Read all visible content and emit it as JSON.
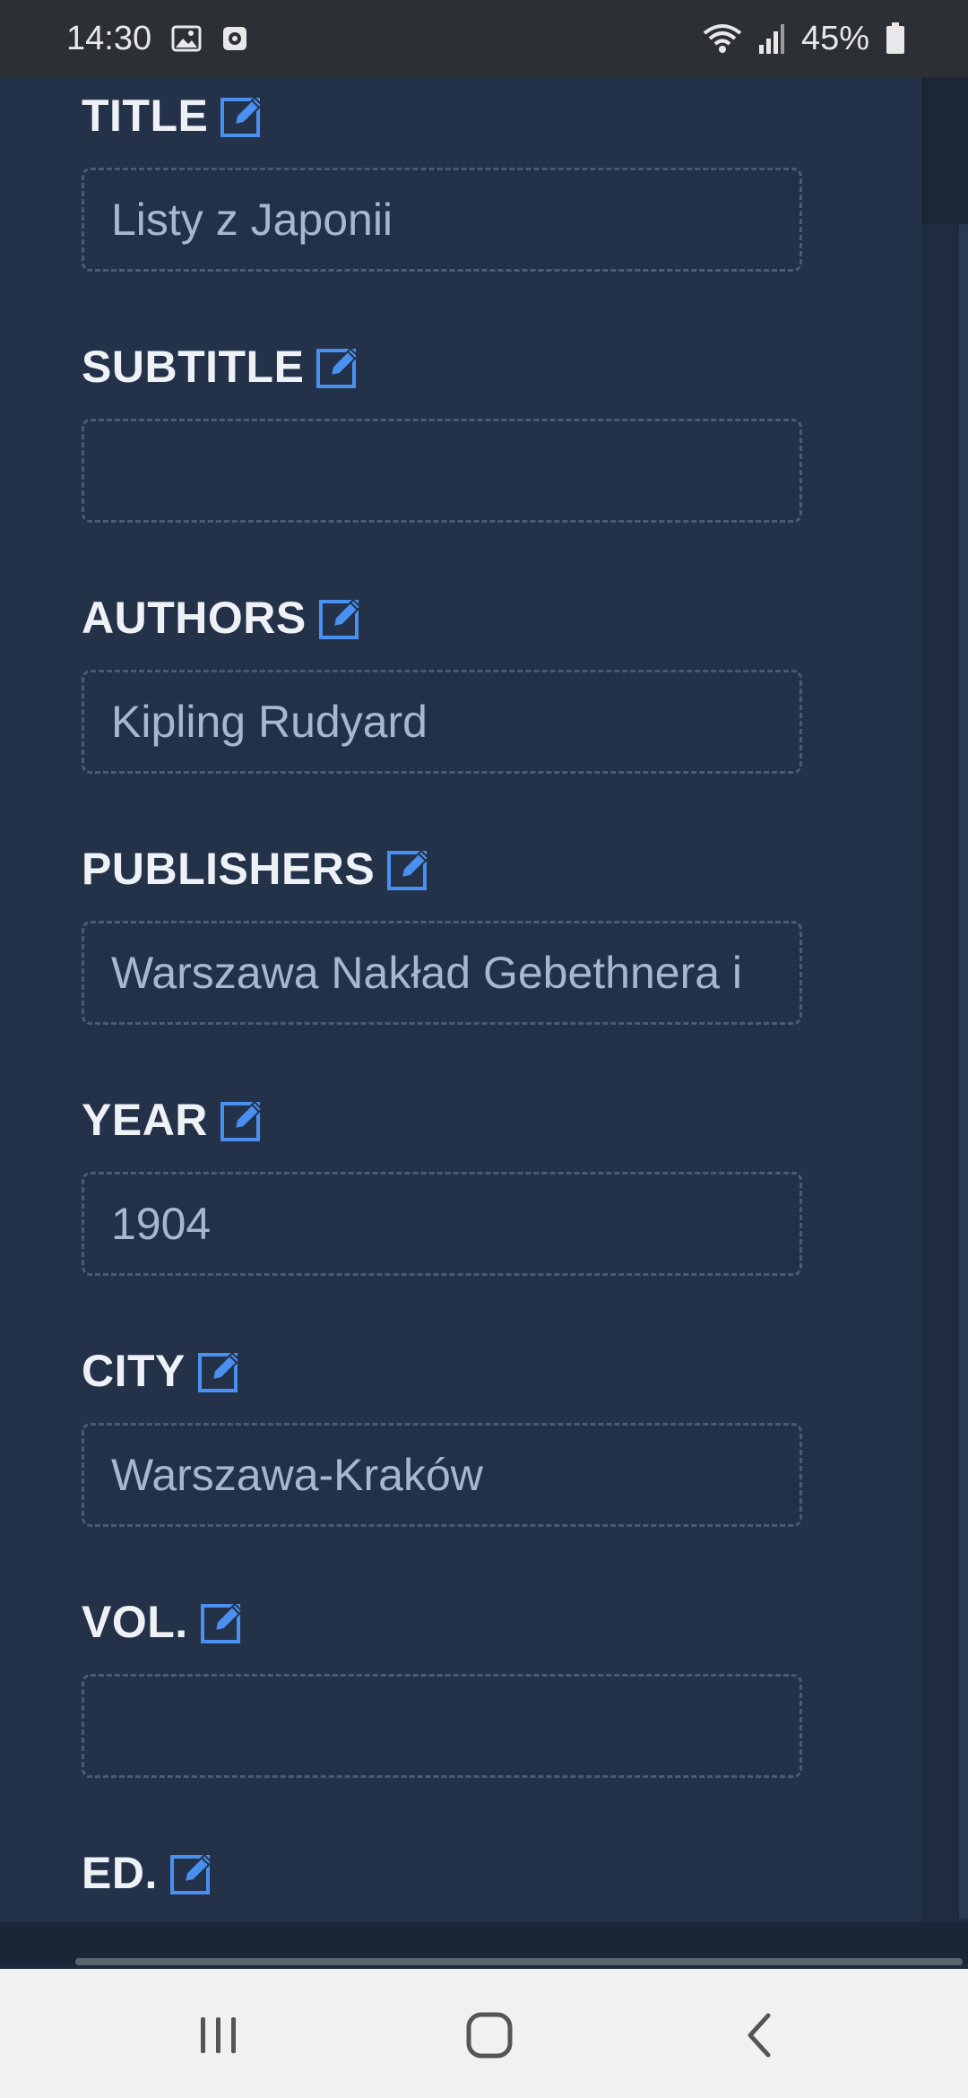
{
  "status_bar": {
    "time": "14:30",
    "left_icons": [
      "image-icon",
      "record-icon"
    ],
    "right_icons": [
      "wifi-icon",
      "signal-icon",
      "battery-icon"
    ],
    "battery": "45%"
  },
  "accent_color": "#4a90f0",
  "fields": [
    {
      "label": "TITLE",
      "value": "Listy z Japonii"
    },
    {
      "label": "SUBTITLE",
      "value": ""
    },
    {
      "label": "AUTHORS",
      "value": "Kipling Rudyard"
    },
    {
      "label": "PUBLISHERS",
      "value": "Warszawa Nakład Gebethnera i"
    },
    {
      "label": "YEAR",
      "value": "1904"
    },
    {
      "label": "CITY",
      "value": "Warszawa-Kraków"
    },
    {
      "label": "VOL.",
      "value": ""
    },
    {
      "label": "ED.",
      "value": ""
    }
  ],
  "nav_bar": {
    "buttons": [
      "recent-apps-icon",
      "home-icon",
      "back-icon"
    ]
  }
}
